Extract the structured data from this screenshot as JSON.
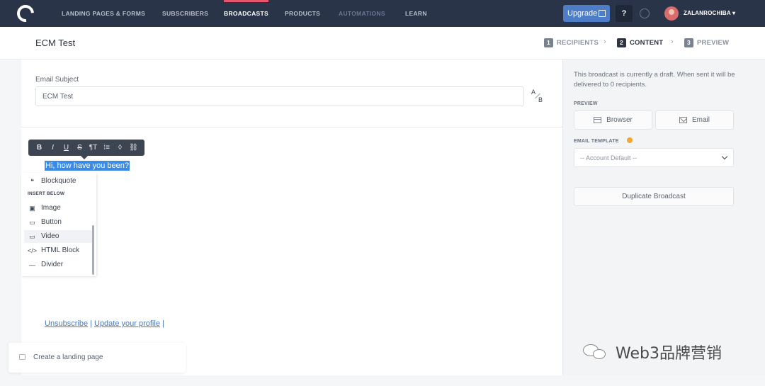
{
  "nav": {
    "items": [
      "LANDING PAGES & FORMS",
      "SUBSCRIBERS",
      "BROADCASTS",
      "PRODUCTS",
      "AUTOMATIONS",
      "LEARN"
    ],
    "upgrade_label": "Upgrade",
    "help_label": "?",
    "username": "ZALANROCHIBA"
  },
  "header": {
    "title": "ECM Test",
    "steps": [
      {
        "num": "1",
        "label": "RECIPIENTS"
      },
      {
        "num": "2",
        "label": "CONTENT"
      },
      {
        "num": "3",
        "label": "PREVIEW"
      }
    ],
    "active_step": "CONTENT"
  },
  "editor": {
    "subject_label": "Email Subject",
    "subject_value": "ECM Test",
    "ab_a": "A",
    "ab_b": "B",
    "toolbar": {
      "bold": "B",
      "italic": "I",
      "underline": "U",
      "strike": "S",
      "heading": "¶T",
      "list": "⁝≡",
      "code": "◊",
      "link": "⛓"
    },
    "selected_text": "Hi, how have you been?",
    "insert_menu": {
      "blockquote": "Blockquote",
      "section_label": "INSERT BELOW",
      "image": "Image",
      "button": "Button",
      "video": "Video",
      "html_block": "HTML Block",
      "divider": "Divider"
    },
    "footer": {
      "unsubscribe": "Unsubscribe",
      "separator": "|",
      "update_profile": "Update your profile"
    }
  },
  "toast": {
    "text": "Create a landing page"
  },
  "sidebar": {
    "draft_note": "This broadcast is currently a draft. When sent it will be delivered to 0 recipients.",
    "preview_label": "PREVIEW",
    "browser_button": "Browser",
    "email_button": "Email",
    "email_template_label": "EMAIL TEMPLATE",
    "template_value": "-- Account Default --",
    "duplicate_button": "Duplicate Broadcast"
  },
  "watermark": {
    "text": "Web3品牌营销"
  },
  "colors": {
    "nav_bg": "#2a3448",
    "nav_active_indicator": "#e5566a",
    "upgrade_bg": "#4d7dc6",
    "selection": "#3a8ae6",
    "link": "#4a78c0",
    "warning": "#f0a830"
  }
}
